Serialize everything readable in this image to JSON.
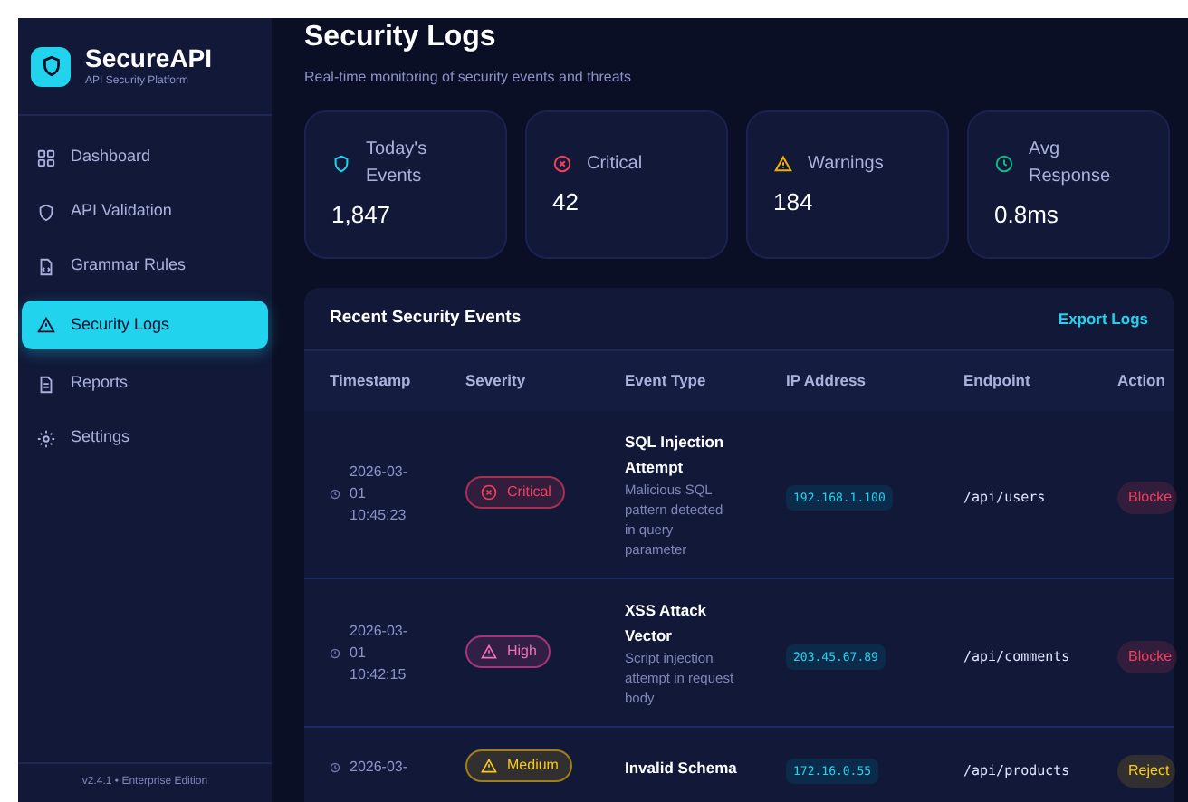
{
  "sidebar": {
    "brand": "SecureAPI",
    "tagline": "API Security Platform",
    "items": [
      {
        "label": "Dashboard",
        "selected": false
      },
      {
        "label": "API Validation",
        "selected": false
      },
      {
        "label": "Grammar Rules",
        "selected": false
      },
      {
        "label": "Security Logs",
        "selected": true
      },
      {
        "label": "Reports",
        "selected": false
      },
      {
        "label": "Settings",
        "selected": false
      }
    ],
    "footer": "v2.4.1 • Enterprise Edition"
  },
  "page": {
    "title": "Security Logs",
    "subtitle": "Real-time monitoring of security events and threats"
  },
  "stats": [
    {
      "label": "Today's Events",
      "value": "1,847",
      "kind": "events"
    },
    {
      "label": "Critical",
      "value": "42",
      "kind": "critical"
    },
    {
      "label": "Warnings",
      "value": "184",
      "kind": "warnings"
    },
    {
      "label": "Avg Response",
      "value": "0.8ms",
      "kind": "response"
    }
  ],
  "events": {
    "title": "Recent Security Events",
    "export": "Export Logs",
    "columns": [
      "Timestamp",
      "Severity",
      "Event Type",
      "IP Address",
      "Endpoint",
      "Action"
    ],
    "rows": [
      {
        "timestamp": "2026-03-01 10:45:23",
        "severity": "Critical",
        "kind": "critical",
        "event": "SQL Injection Attempt",
        "description": "Malicious SQL pattern detected in query parameter",
        "ip": "192.168.1.100",
        "endpoint": "/api/users",
        "action": "Blocke"
      },
      {
        "timestamp": "2026-03-01 10:42:15",
        "severity": "High",
        "kind": "high",
        "event": "XSS Attack Vector",
        "description": "Script injection attempt in request body",
        "ip": "203.45.67.89",
        "endpoint": "/api/comments",
        "action": "Blocke"
      },
      {
        "timestamp": "2026-03-",
        "severity": "Medium",
        "kind": "medium",
        "event": "Invalid Schema",
        "ip": "172.16.0.55",
        "endpoint": "/api/products",
        "action": "Reject"
      }
    ]
  }
}
